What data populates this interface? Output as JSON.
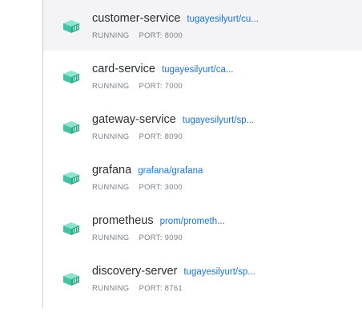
{
  "accent_color": "#3fc4a5",
  "containers": [
    {
      "name": "customer-service",
      "image": "tugayesilyurt/cu...",
      "status": "RUNNING",
      "port": "PORT: 8000",
      "icon": "container-icon"
    },
    {
      "name": "card-service",
      "image": "tugayesilyurt/ca...",
      "status": "RUNNING",
      "port": "PORT: 7000",
      "icon": "container-icon"
    },
    {
      "name": "gateway-service",
      "image": "tugayesilyurt/sp...",
      "status": "RUNNING",
      "port": "PORT: 8090",
      "icon": "container-icon"
    },
    {
      "name": "grafana",
      "image": "grafana/grafana",
      "status": "RUNNING",
      "port": "PORT: 3000",
      "icon": "container-icon"
    },
    {
      "name": "prometheus",
      "image": "prom/prometh...",
      "status": "RUNNING",
      "port": "PORT: 9090",
      "icon": "container-icon"
    },
    {
      "name": "discovery-server",
      "image": "tugayesilyurt/sp...",
      "status": "RUNNING",
      "port": "PORT: 8761",
      "icon": "container-icon"
    }
  ]
}
